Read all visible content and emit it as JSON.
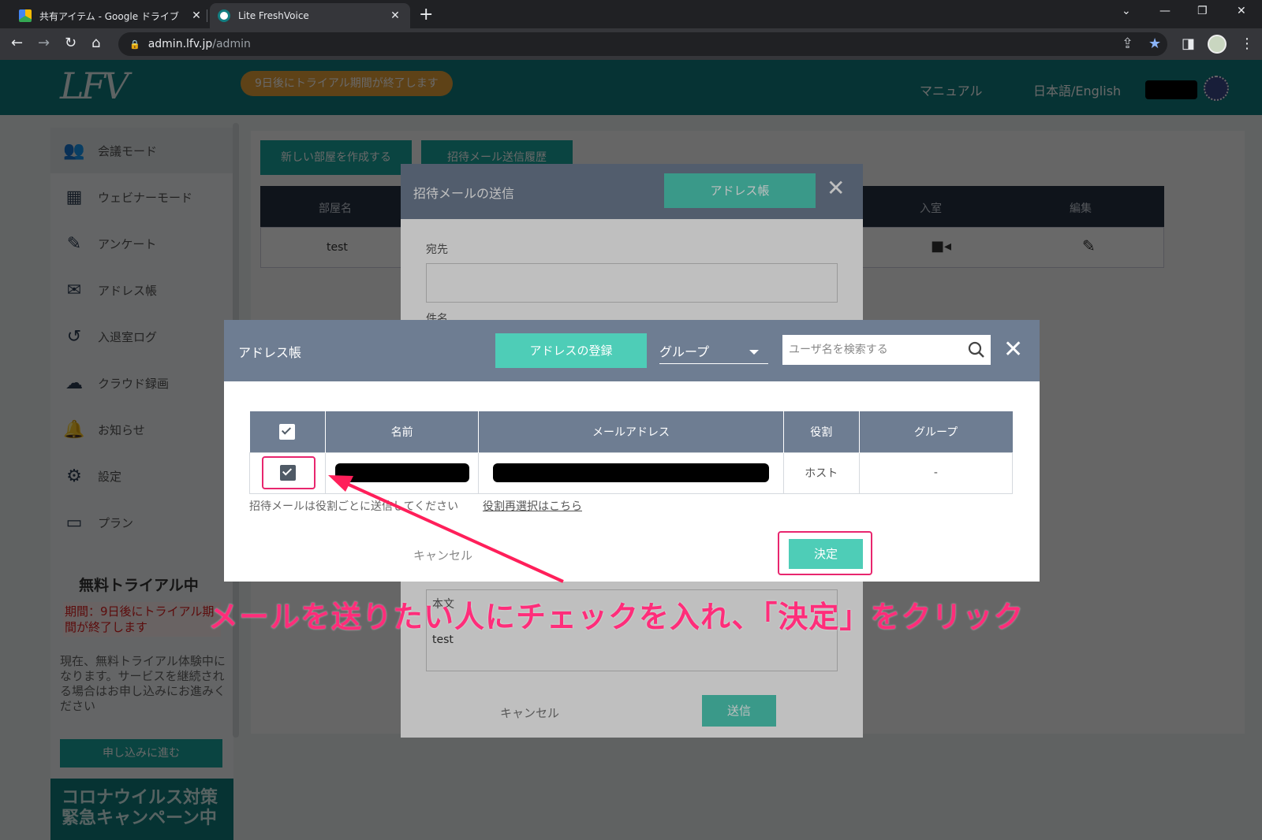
{
  "browser": {
    "tabs": [
      {
        "title": "共有アイテム - Google ドライブ",
        "active": false
      },
      {
        "title": "Lite FreshVoice",
        "active": true
      }
    ],
    "url_host": "admin.lfv.jp",
    "url_path": "/admin"
  },
  "header": {
    "logo": "LFV",
    "trial_notice": "9日後にトライアル期間が終了します",
    "manual": "マニュアル",
    "language": "日本語/English"
  },
  "sidebar": {
    "items": [
      {
        "label": "会議モード",
        "icon": "people-icon"
      },
      {
        "label": "ウェビナーモード",
        "icon": "presentation-icon"
      },
      {
        "label": "アンケート",
        "icon": "edit-icon"
      },
      {
        "label": "アドレス帳",
        "icon": "mail-icon"
      },
      {
        "label": "入退室ログ",
        "icon": "history-icon"
      },
      {
        "label": "クラウド録画",
        "icon": "cloud-icon"
      },
      {
        "label": "お知らせ",
        "icon": "bell-icon"
      },
      {
        "label": "設定",
        "icon": "gear-icon"
      },
      {
        "label": "プラン",
        "icon": "card-icon"
      }
    ],
    "trial_title": "無料トライアル中",
    "trial_period": "期間：9日後にトライアル期間が終了します",
    "trial_text": "現在、無料トライアル体験中になります。サービスを継続される場合はお申し込みにお進みください",
    "apply_button": "申し込みに進む",
    "campaign": "コロナウイルス対策 緊急キャンペーン中"
  },
  "main": {
    "new_room_button": "新しい部屋を作成する",
    "history_button": "招待メール送信履歴",
    "table_headers": [
      "部屋名",
      "入室",
      "編集"
    ],
    "row_room_name": "test"
  },
  "invite_modal": {
    "title": "招待メールの送信",
    "address_book_button": "アドレス帳",
    "to_label": "宛先",
    "subject_label": "件名",
    "body_label": "本文",
    "body_value": "test",
    "cancel": "キャンセル",
    "send": "送信"
  },
  "address_book": {
    "title": "アドレス帳",
    "register_button": "アドレスの登録",
    "group_select": "グループ",
    "search_placeholder": "ユーザ名を検索する",
    "columns": [
      "名前",
      "メールアドレス",
      "役割",
      "グループ"
    ],
    "rows": [
      {
        "checked": true,
        "name": "[redacted]",
        "email": "[redacted]",
        "role": "ホスト",
        "group": "-"
      }
    ],
    "note": "招待メールは役割ごとに送信してください",
    "reselect_link": "役割再選択はこちら",
    "cancel": "キャンセル",
    "confirm": "決定"
  },
  "annotation": {
    "caption": "メールを送りたい人にチェックを入れ、「決定」をクリック",
    "color": "#e8266e"
  }
}
